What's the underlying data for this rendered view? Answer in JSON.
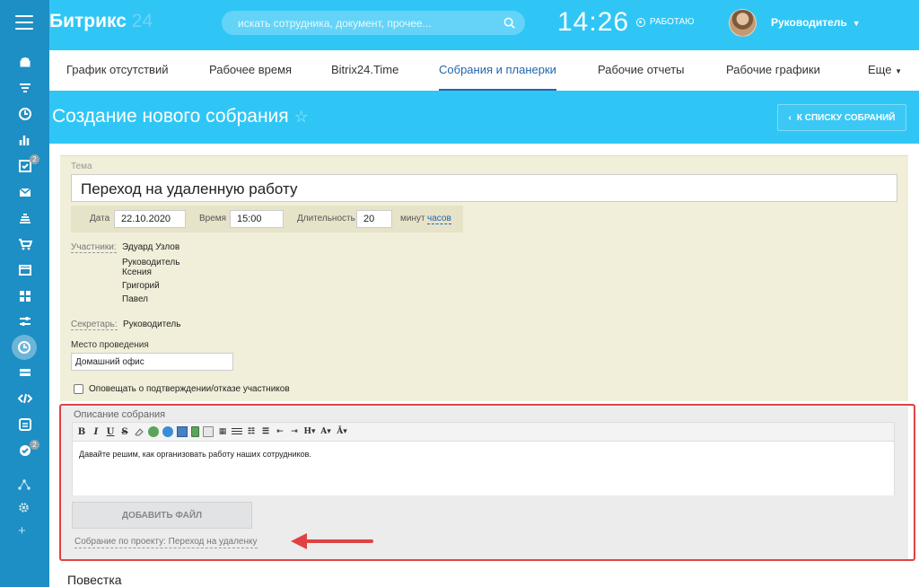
{
  "topbar": {
    "logo_main": "Битрикс",
    "logo_num": "24",
    "search_placeholder": "искать сотрудника, документ, прочее...",
    "clock": "14:26",
    "work_status": "РАБОТАЮ",
    "user_name": "Руководитель"
  },
  "rail": {
    "badges": [
      "2",
      "2"
    ]
  },
  "tabs": [
    "График отсутствий",
    "Рабочее время",
    "Bitrix24.Time",
    "Собрания и планерки",
    "Рабочие отчеты",
    "Рабочие графики",
    "Еще"
  ],
  "header": {
    "title": "Создание нового собрания",
    "back_button": "К СПИСКУ СОБРАНИЙ"
  },
  "form": {
    "topic_label": "Тема",
    "topic_value": "Переход на удаленную работу",
    "date_label": "Дата",
    "date_value": "22.10.2020",
    "time_label": "Время",
    "time_value": "15:00",
    "duration_label": "Длительность",
    "duration_value": "20",
    "minutes_label": "минут",
    "hours_link": "часов",
    "participants_label": "Участники:",
    "participants": [
      "Эдуард Узлов",
      "Руководитель",
      "Ксения",
      "Григорий",
      "Павел"
    ],
    "secretary_label": "Секретарь:",
    "secretary_value": "Руководитель",
    "place_label": "Место проведения",
    "place_value": "Домашний офис",
    "notify_label": "Оповещать о подтверждении/отказе участников"
  },
  "description": {
    "title": "Описание собрания",
    "text": "Давайте решим, как организовать работу наших сотрудников.",
    "add_file": "ДОБАВИТЬ ФАЙЛ",
    "project_link": "Собрание по проекту: Переход на удаленку",
    "toolbar_glyphs": [
      "B",
      "I",
      "U",
      "S"
    ]
  },
  "agenda_title": "Повестка",
  "colors": {
    "brand_bg": "#2fc6f6",
    "accent_blue": "#2067b0",
    "form_bg": "#f1efd9",
    "annotation_red": "#e04242"
  }
}
